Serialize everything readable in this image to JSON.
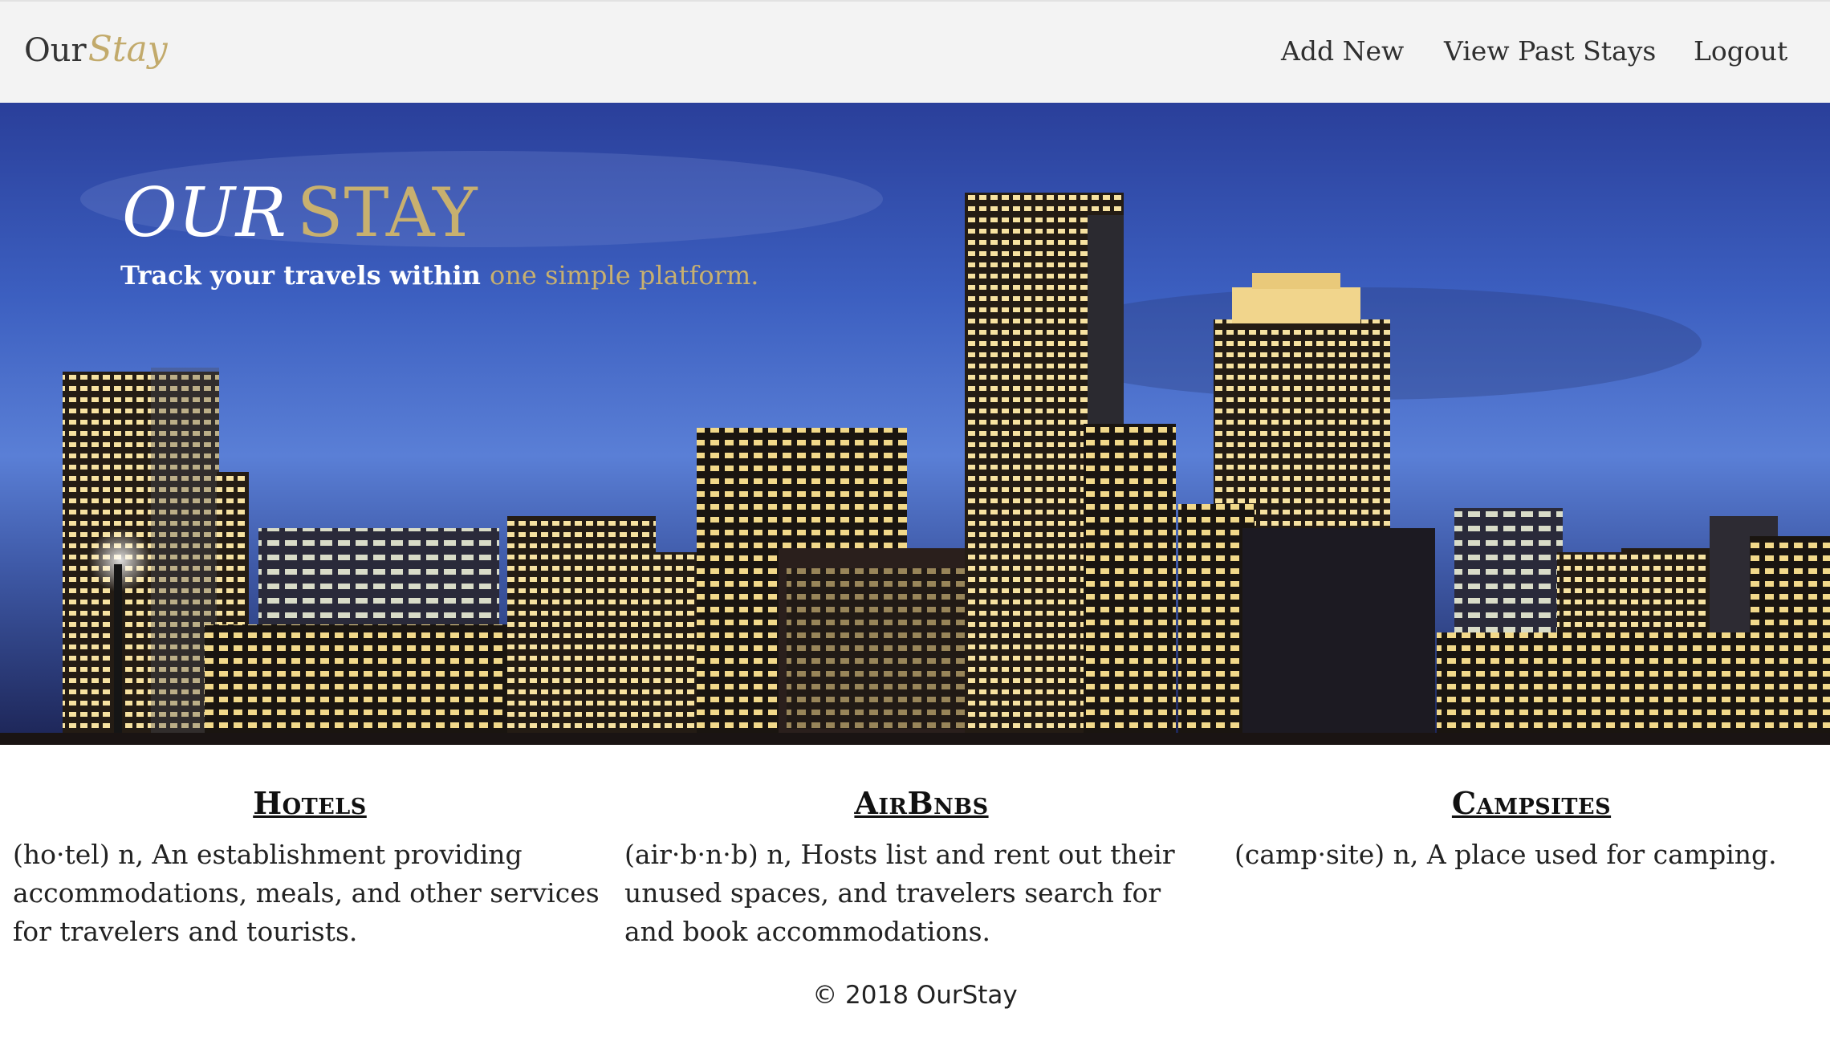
{
  "navbar": {
    "brand_our": "Our",
    "brand_stay": "Stay",
    "links": [
      "Add New",
      "View Past Stays",
      "Logout"
    ]
  },
  "hero": {
    "title_our": "OUR",
    "title_stay": "STAY",
    "subtitle_prefix": "Track your travels within ",
    "subtitle_highlight": "one simple platform."
  },
  "cards": [
    {
      "title": "Hotels",
      "text": "(ho·tel) n, An establishment providing accommodations, meals, and other services for travelers and tourists."
    },
    {
      "title": "AirBnbs",
      "text": "(air·b·n·b) n, Hosts list and rent out their unused spaces, and travelers search for and book accommodations."
    },
    {
      "title": "Campsites",
      "text": "(camp·site) n, A place used for camping."
    }
  ],
  "footer": {
    "text": "© 2018 OurStay"
  },
  "colors": {
    "accent": "#c2aa6b",
    "navbar_bg": "#f3f3f3"
  }
}
